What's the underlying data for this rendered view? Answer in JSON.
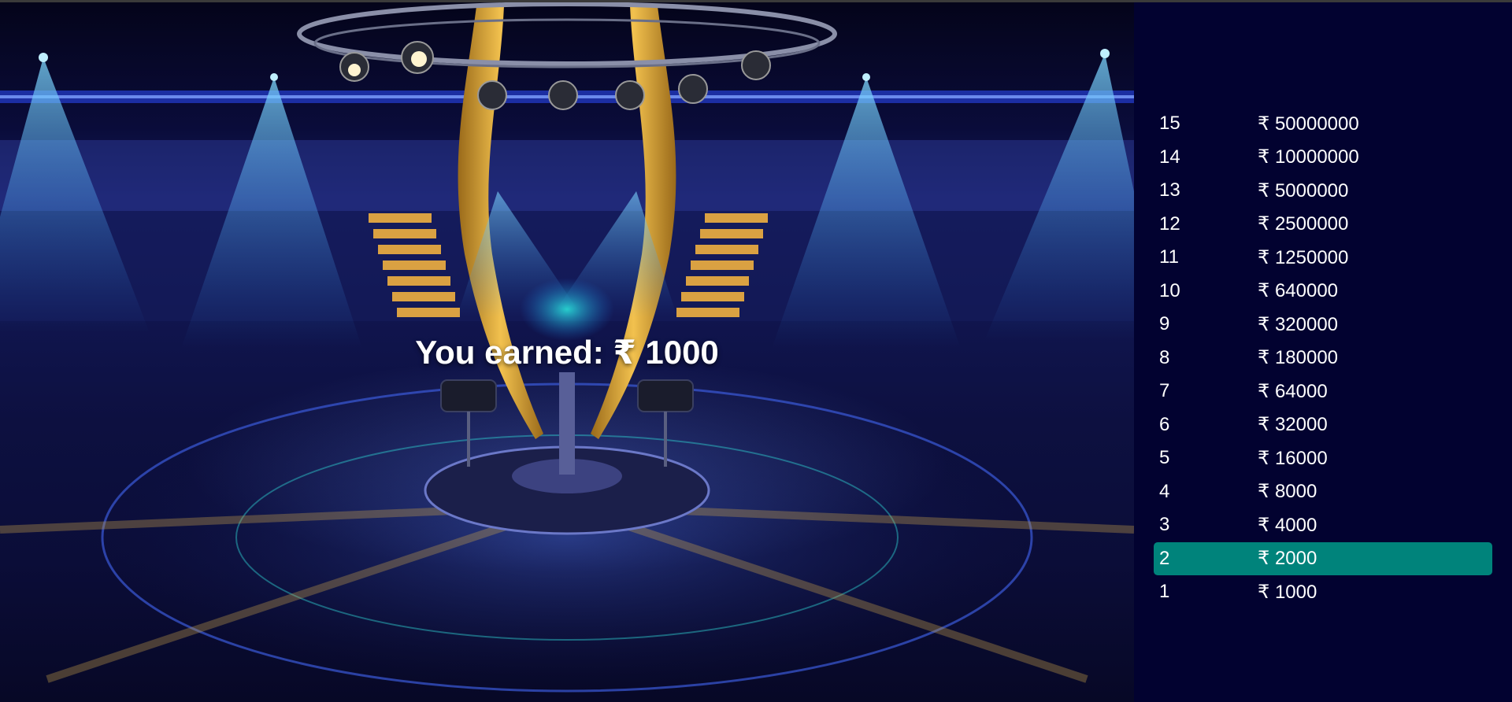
{
  "result": {
    "earned_label": "You earned:",
    "currency": "₹",
    "earned_amount": "1000",
    "earned_text": "You earned: ₹ 1000"
  },
  "money_ladder": {
    "active_level": 2,
    "levels": [
      {
        "number": "15",
        "amount": "₹ 50000000"
      },
      {
        "number": "14",
        "amount": "₹ 10000000"
      },
      {
        "number": "13",
        "amount": "₹ 5000000"
      },
      {
        "number": "12",
        "amount": "₹ 2500000"
      },
      {
        "number": "11",
        "amount": "₹ 1250000"
      },
      {
        "number": "10",
        "amount": "₹ 640000"
      },
      {
        "number": "9",
        "amount": "₹ 320000"
      },
      {
        "number": "8",
        "amount": "₹ 180000"
      },
      {
        "number": "7",
        "amount": "₹ 64000"
      },
      {
        "number": "6",
        "amount": "₹ 32000"
      },
      {
        "number": "5",
        "amount": "₹ 16000"
      },
      {
        "number": "4",
        "amount": "₹ 8000"
      },
      {
        "number": "3",
        "amount": "₹ 4000"
      },
      {
        "number": "2",
        "amount": "₹ 2000"
      },
      {
        "number": "1",
        "amount": "₹ 1000"
      }
    ]
  },
  "colors": {
    "ladder_background": "#020230",
    "active_highlight": "#00837b",
    "text": "#ffffff"
  }
}
